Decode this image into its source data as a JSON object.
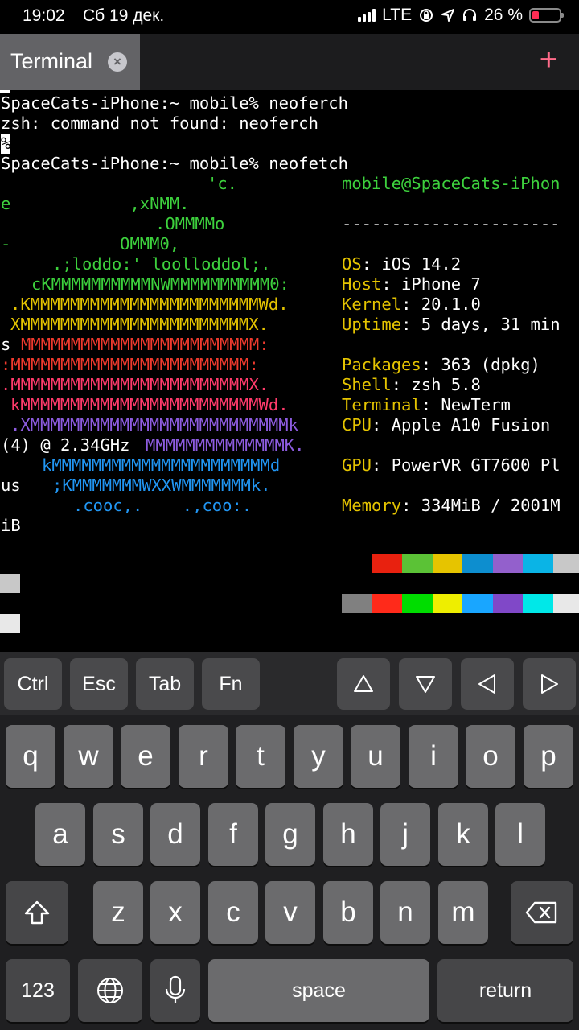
{
  "status_bar": {
    "time": "19:02",
    "date": "Сб 19 дек.",
    "network": "LTE",
    "battery": "26 %",
    "battery_level": 0.26
  },
  "tab_bar": {
    "tab_title": "Terminal",
    "close_icon": "x-circle-icon",
    "add_icon": "plus-icon",
    "accent_color": "#ff6b8a"
  },
  "terminal": {
    "lines": [
      "SpaceCats-iPhone:~ mobile% neoferch",
      "zsh: command not found: neoferch",
      "%",
      "SpaceCats-iPhone:~ mobile% neofetch"
    ],
    "logo": [
      "'c.",
      "e            ,xNMM.",
      ".OMMMMo",
      "-           OMMM0,",
      ".;loddo:' loolloddol;.",
      "cKMMMMMMMMMMNWMMMMMMMMMM0:",
      ".KMMMMMMMMMMMMMMMMMMMMMMMWd.",
      "XMMMMMMMMMMMMMMMMMMMMMMMX.",
      "s ",
      "MMMMMMMMMMMMMMMMMMMMMMMM:",
      ":MMMMMMMMMMMMMMMMMMMMMMMM:",
      ".MMMMMMMMMMMMMMMMMMMMMMMMX.",
      "kMMMMMMMMMMMMMMMMMMMMMMMMWd.",
      ".XMMMMMMMMMMMMMMMMMMMMMMMMMMk",
      "(4) @ 2.34GHz ",
      "MMMMMMMMMMMMMMK.",
      "kMMMMMMMMMMMMMMMMMMMMMMd",
      "us    ",
      ";KMMMMMMMWXXWMMMMMMMk.",
      ".cooc,.    .,coo:.",
      "iB"
    ],
    "info": {
      "header": "mobile@SpaceCats-iPhon",
      "separator": "----------------------",
      "os_key": "OS",
      "os_val": ": iOS 14.2",
      "host_key": "Host",
      "host_val": ": iPhone 7",
      "kernel_key": "Kernel",
      "kernel_val": ": 20.1.0",
      "uptime_key": "Uptime",
      "uptime_val": ": 5 days, 31 min",
      "packages_key": "Packages",
      "packages_val": ": 363 (dpkg)",
      "shell_key": "Shell",
      "shell_val": ": zsh 5.8",
      "terminal_key": "Terminal",
      "terminal_val": ": NewTerm",
      "cpu_key": "CPU",
      "cpu_val": ": Apple A10 Fusion",
      "gpu_key": "GPU",
      "gpu_val": ": PowerVR GT7600 Pl",
      "memory_key": "Memory",
      "memory_val": ": 334MiB / 2001M"
    },
    "palette_dark": [
      "#000000",
      "#e8210f",
      "#5bc236",
      "#e6c400",
      "#0d8ecf",
      "#9360cc",
      "#0ab4e6",
      "#c8c8c8"
    ],
    "palette_bright": [
      "#808080",
      "#ff2a1a",
      "#00dd00",
      "#eeee00",
      "#19a6ff",
      "#8048c8",
      "#00e8e8",
      "#e8e8e8"
    ]
  },
  "toolbar": {
    "ctrl": "Ctrl",
    "esc": "Esc",
    "tab": "Tab",
    "fn": "Fn",
    "up_icon": "triangle-up-icon",
    "down_icon": "triangle-down-icon",
    "left_icon": "triangle-left-icon",
    "right_icon": "triangle-right-icon"
  },
  "keyboard": {
    "row1": [
      "q",
      "w",
      "e",
      "r",
      "t",
      "y",
      "u",
      "i",
      "o",
      "p"
    ],
    "row2": [
      "a",
      "s",
      "d",
      "f",
      "g",
      "h",
      "j",
      "k",
      "l"
    ],
    "row3": [
      "z",
      "x",
      "c",
      "v",
      "b",
      "n",
      "m"
    ],
    "numbers": "123",
    "space": "space",
    "return": "return",
    "shift_icon": "shift-icon",
    "delete_icon": "delete-icon",
    "globe_icon": "globe-icon",
    "mic_icon": "microphone-icon"
  }
}
